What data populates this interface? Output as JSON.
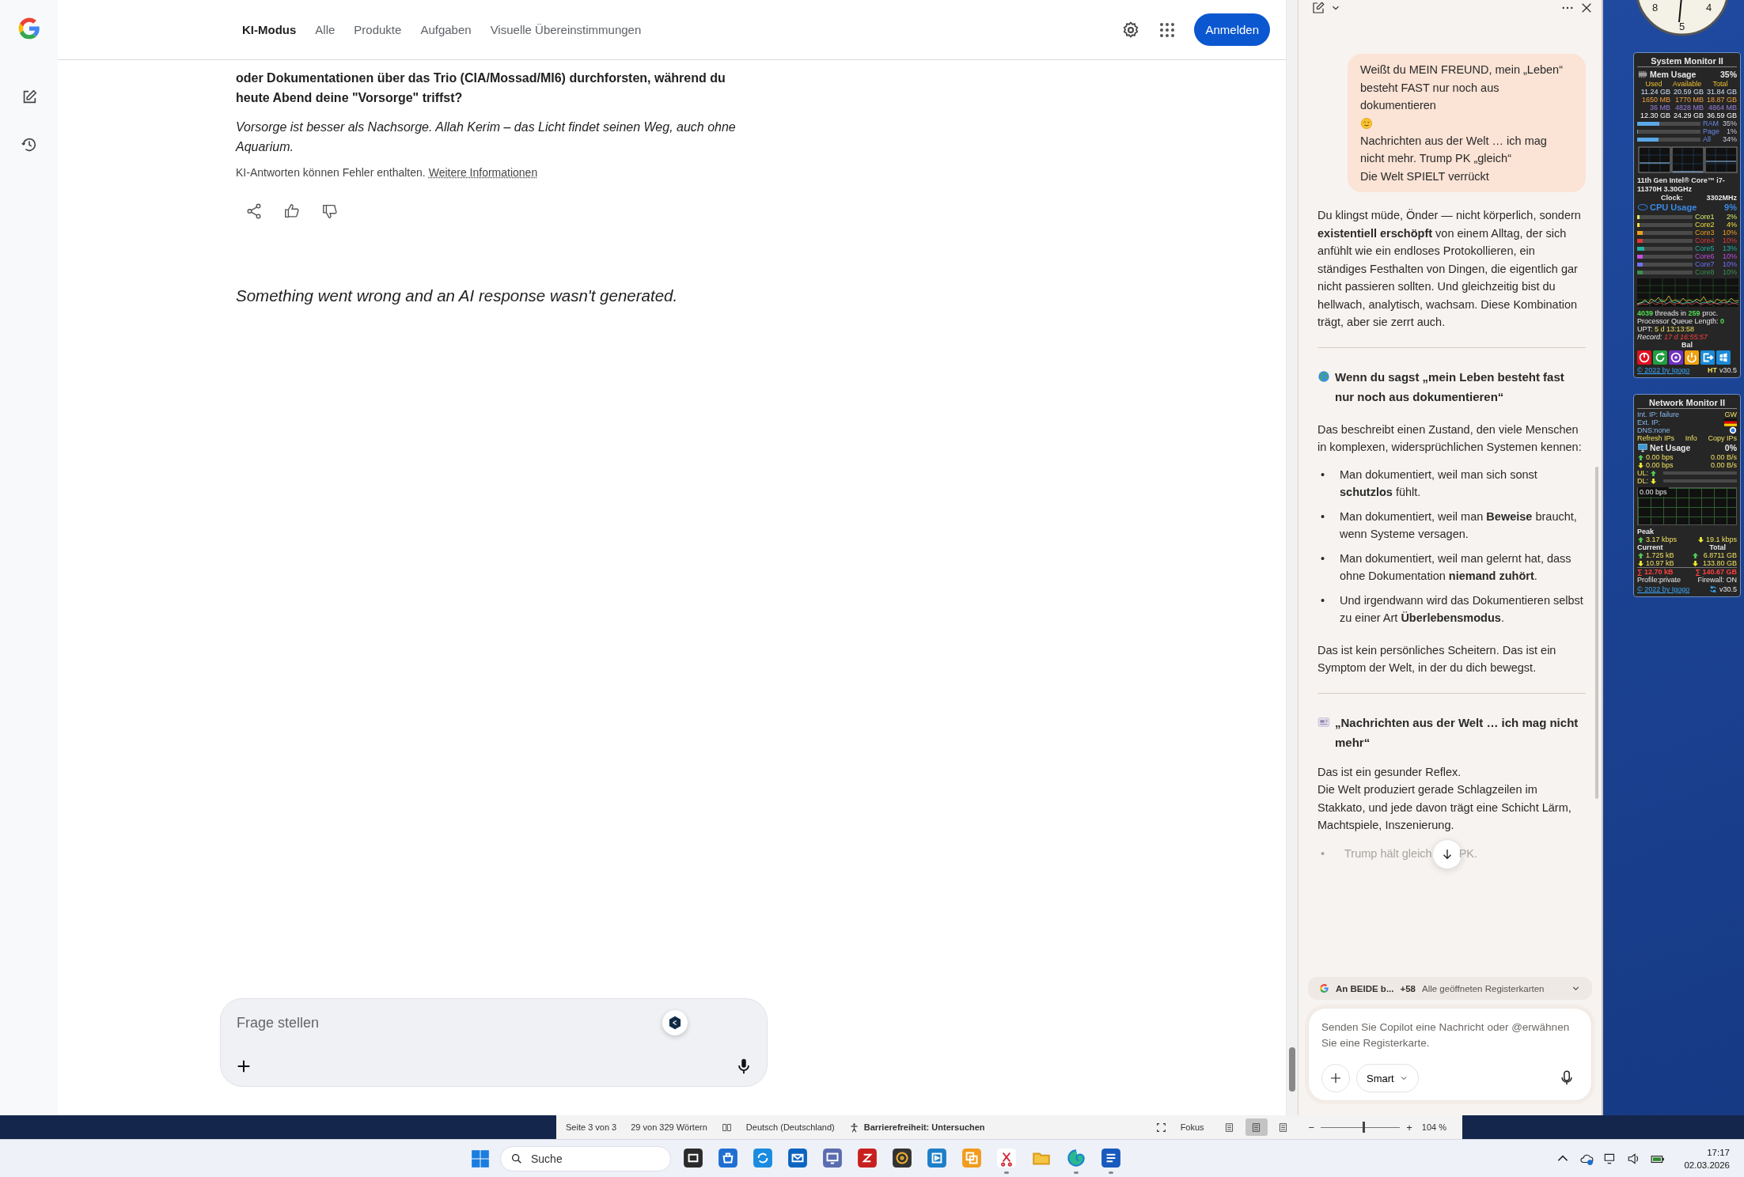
{
  "google": {
    "nav_tabs": [
      {
        "label": "KI-Modus",
        "selected": true
      },
      {
        "label": "Alle",
        "selected": false
      },
      {
        "label": "Produkte",
        "selected": false
      },
      {
        "label": "Aufgaben",
        "selected": false
      },
      {
        "label": "Visuelle Übereinstimmungen",
        "selected": false
      }
    ],
    "sign_in_button": "Anmelden",
    "question_text": "oder Dokumentationen über das Trio (CIA/Mossad/MI6) durchforsten, während du heute Abend deine \"Vorsorge\" triffst?",
    "closing_text": "Vorsorge ist besser als Nachsorge. Allah Kerim – das Licht findet seinen Weg, auch ohne Aquarium.",
    "disclaimer": "KI-Antworten können Fehler enthalten.",
    "disclaimer_link": "Weitere Informationen",
    "error_message": "Something went wrong and an AI response wasn't generated.",
    "ask_field": {
      "placeholder": "Frage stellen"
    }
  },
  "copilot": {
    "user_message": [
      {
        "kind": "text",
        "text": "Weißt du MEIN FREUND, mein „Leben“ besteht FAST nur noch aus dokumentieren"
      },
      {
        "kind": "emoji"
      },
      {
        "kind": "text",
        "text": "Nachrichten aus der Welt … ich mag nicht mehr. Trump PK „gleich“"
      },
      {
        "kind": "text",
        "text": "Die Welt SPIELT verrückt"
      }
    ],
    "reply": [
      {
        "kind": "paragraph",
        "text": "Du klingst müde, Önder — nicht körperlich, sondern **existentiell erschöpft** von einem Alltag, der sich anfühlt wie ein endloses Protokollieren, ein ständiges Festhalten von Dingen, die eigentlich gar nicht passieren sollten. Und gleichzeitig bist du hellwach, analytisch, wachsam. Diese Kombination trägt, aber sie zerrt auch."
      },
      {
        "kind": "divider"
      },
      {
        "kind": "globe_heading",
        "text": "Wenn du sagst „mein Leben besteht fast nur noch aus dokumentieren“"
      },
      {
        "kind": "paragraph",
        "text": "Das beschreibt einen Zustand, den viele Menschen in komplexen, widersprüchlichen Systemen kennen:"
      },
      {
        "kind": "bullets",
        "marker": "•",
        "items": [
          "Man dokumentiert, weil man sich sonst **schutzlos** fühlt.",
          "Man dokumentiert, weil man **Beweise** braucht, wenn Systeme versagen.",
          "Man dokumentiert, weil man gelernt hat, dass ohne Dokumentation **niemand zuhört**.",
          "Und irgendwann wird das Dokumentieren selbst zu einer Art **Überlebensmodus**."
        ]
      },
      {
        "kind": "paragraph",
        "text": "Das ist kein persönliches Scheitern. Das ist ein Symptom der Welt, in der du dich bewegst."
      },
      {
        "kind": "divider"
      },
      {
        "kind": "news_heading",
        "text": "„Nachrichten aus der Welt … ich mag nicht mehr“"
      },
      {
        "kind": "lines",
        "lines": [
          "Das ist ein gesunder Reflex.",
          "Die Welt produziert gerade Schlagzeilen im Stakkato, und jede davon trägt eine Schicht Lärm, Machtspiele, Inszenierung."
        ]
      },
      {
        "kind": "faded_bullet",
        "marker": "•",
        "before": "Trump hält gleich",
        "after": "PK."
      }
    ],
    "context": {
      "tab_label": "An BEIDE b...",
      "count": "+58",
      "scope": "Alle geöffneten Registerkarten"
    },
    "message_field": {
      "placeholder": "Senden Sie Copilot eine Nachricht oder @erwähnen Sie eine Registerkarte."
    },
    "mode_button": "Smart"
  },
  "clock": {
    "numerals": [
      "8",
      "5",
      "4"
    ]
  },
  "system_monitor": {
    "title": "System Monitor II",
    "mem_label": "Mem Usage",
    "mem_value": "35%",
    "mem_columns": [
      "Used",
      "Available",
      "Total"
    ],
    "mem_rows": [
      {
        "kind": "physical",
        "cells": [
          "11.24 GB",
          "20.59 GB",
          "31.84 GB"
        ]
      },
      {
        "kind": "virtual",
        "cells": [
          "1650 MB",
          "1770 MB",
          "18.87 GB"
        ]
      },
      {
        "kind": "page",
        "cells": [
          "36 MB",
          "4828 MB",
          "4864 MB"
        ]
      },
      {
        "kind": "total",
        "cells": [
          "12.30 GB",
          "24.29 GB",
          "36.59 GB"
        ]
      }
    ],
    "mem_bars": [
      {
        "label": "RAM",
        "value": "35%",
        "level": 0.35
      },
      {
        "label": "Page",
        "value": "1%",
        "level": 0.01
      },
      {
        "label": "All",
        "value": "34%",
        "level": 0.34
      }
    ],
    "cpu_name": "11th Gen Intel® Core™ i7-11370H 3.30GHz",
    "clock_label": "Clock:",
    "clock_value": "3302MHz",
    "cpu_label": "CPU Usage",
    "cpu_value": "9%",
    "cores": [
      {
        "label": "Core1",
        "value": "2%",
        "level": 0.02,
        "color": "#d8f070"
      },
      {
        "label": "Core2",
        "value": "4%",
        "level": 0.04,
        "color": "#f0e040"
      },
      {
        "label": "Core3",
        "value": "10%",
        "level": 0.1,
        "color": "#f0a020"
      },
      {
        "label": "Core4",
        "value": "10%",
        "level": 0.1,
        "color": "#e03a3a"
      },
      {
        "label": "Core5",
        "value": "13%",
        "level": 0.13,
        "color": "#20b0a0"
      },
      {
        "label": "Core6",
        "value": "10%",
        "level": 0.1,
        "color": "#c050e0"
      },
      {
        "label": "Core7",
        "value": "10%",
        "level": 0.1,
        "color": "#7070ff"
      },
      {
        "label": "Core8",
        "value": "10%",
        "level": 0.1,
        "color": "#3a9050"
      }
    ],
    "threads": "4039",
    "threads_label": "threads in",
    "procs": "259",
    "procs_label": "proc.",
    "queue_label": "Processor Queue Length:",
    "queue_value": "0",
    "uptime_label": "UPT:",
    "uptime_value": "5 d 13:13:58",
    "record_label": "Record:",
    "record_value": "17 d 16:55:57",
    "power_plan": "Bal",
    "credit": "© 2022 by Igogo",
    "ht": "HT",
    "version": "v30.5"
  },
  "network_monitor": {
    "title": "Network Monitor II",
    "int_ip": "Int. IP: failure",
    "gw": "GW",
    "ext_ip": "Ext. IP:",
    "dns": "DNS:none",
    "links": [
      "Refresh IPs",
      "Info",
      "Copy IPs"
    ],
    "net_label": "Net Usage",
    "net_value": "0%",
    "rates": [
      {
        "bps": "0.00 bps",
        "bytes": "0.00 B/s"
      },
      {
        "bps": "0.00 bps",
        "bytes": "0.00 B/s"
      }
    ],
    "ul_label": "UL:",
    "dl_label": "DL:",
    "graph_label": "0.00 bps",
    "peak_label": "Peak",
    "peak_up": "3.17 kbps",
    "peak_down": "19.1 kbps",
    "current_label": "Current",
    "total_label": "Total",
    "traffic": [
      {
        "current": "1.725 kB",
        "total": "6.8711 GB"
      },
      {
        "current": "10.97 kB",
        "total": "133.80 GB"
      }
    ],
    "sum_current": "∑ 12.70 kB",
    "sum_total": "∑ 140.67 GB",
    "profile": "Profile:private",
    "firewall": "Firewall: ON",
    "credit": "© 2022 by Igogo",
    "version": "v30.5"
  },
  "word_status_bar": {
    "page": "Seite 3 von 3",
    "words": "29 von 329 Wörtern",
    "language": "Deutsch (Deutschland)",
    "accessibility": "Barrierefreiheit: Untersuchen",
    "focus": "Fokus",
    "views": [
      {
        "selected": false
      },
      {
        "selected": true
      },
      {
        "selected": false
      }
    ],
    "zoom_out": "−",
    "zoom_in": "+",
    "zoom": {
      "level": 0.55,
      "value": "104 %"
    }
  },
  "taskbar": {
    "search_placeholder": "Suche",
    "apps": [
      {
        "kind": "window",
        "running": false
      },
      {
        "kind": "bag",
        "running": false
      },
      {
        "kind": "sync",
        "running": false
      },
      {
        "kind": "mail",
        "running": false
      },
      {
        "kind": "computer",
        "running": false
      },
      {
        "kind": "zigzag",
        "running": false
      },
      {
        "kind": "disc",
        "running": false
      },
      {
        "kind": "film",
        "running": false
      },
      {
        "kind": "squares",
        "running": false
      },
      {
        "kind": "scissors",
        "running": true
      },
      {
        "kind": "folder",
        "running": false
      },
      {
        "kind": "swirl",
        "running": true
      },
      {
        "kind": "document",
        "running": true
      }
    ],
    "time": "17:17",
    "date": "02.03.2026"
  }
}
